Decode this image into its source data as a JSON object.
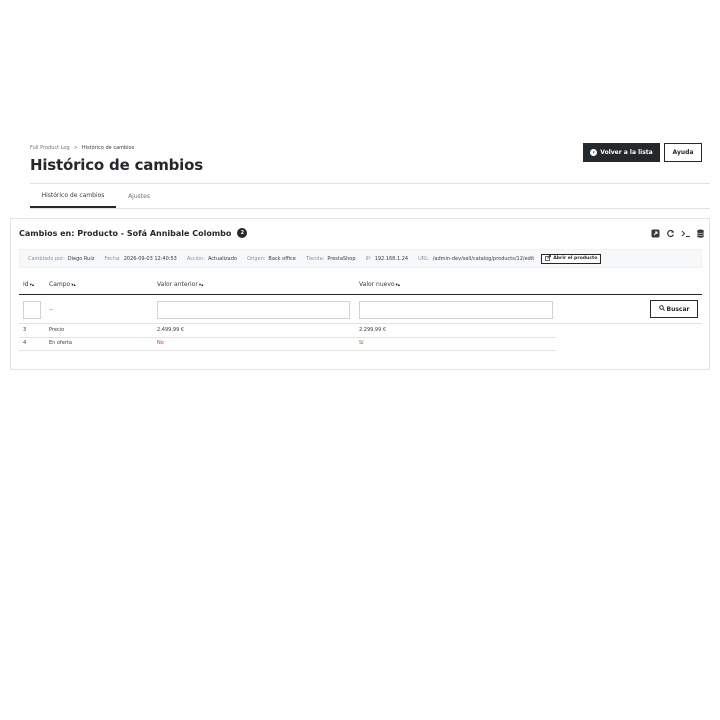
{
  "breadcrumb": {
    "parent": "Full Product Log",
    "separator": ">",
    "current": "Histórico de cambios"
  },
  "page": {
    "title": "Histórico de cambios"
  },
  "header_buttons": {
    "back": "Volver a la lista",
    "help": "Ayuda"
  },
  "tabs": [
    {
      "label": "Histórico de cambios",
      "active": true
    },
    {
      "label": "Ajustes",
      "active": false
    }
  ],
  "panel": {
    "title": "Cambios en: Producto - Sofá Annibale Colombo",
    "count": "2",
    "toolbar_icons": [
      "export-icon",
      "refresh-icon",
      "terminal-icon",
      "database-icon"
    ]
  },
  "meta": {
    "changed_by_label": "Cambiado por:",
    "changed_by": "Diego Ruiz",
    "date_label": "Fecha:",
    "date": "2026-09-03 12:40:53",
    "action_label": "Acción:",
    "action": "Actualizado",
    "origin_label": "Origen:",
    "origin": "Back office",
    "shop_label": "Tienda:",
    "shop": "PrestaShop",
    "ip_label": "IP:",
    "ip": "192.168.1.24",
    "url_label": "URL:",
    "url": "/admin-dev/sell/catalog/products/12/edit",
    "open_button": "Abrir el producto"
  },
  "table": {
    "columns": [
      "Id",
      "Campo",
      "Valor anterior",
      "Valor nuevo"
    ],
    "filter": {
      "campo_value": "--",
      "search_button": "Buscar"
    },
    "rows": [
      {
        "id": "3",
        "campo": "Precio",
        "old": "2.499,99 €",
        "new": "2.299,99 €"
      },
      {
        "id": "4",
        "campo": "En oferta",
        "old": "No",
        "new": "Sí"
      }
    ]
  },
  "colors": {
    "primary": "#25282b",
    "old_value": "#c9302c",
    "new_value": "#3d8b1e",
    "meta_bg": "#f7f8fa"
  }
}
